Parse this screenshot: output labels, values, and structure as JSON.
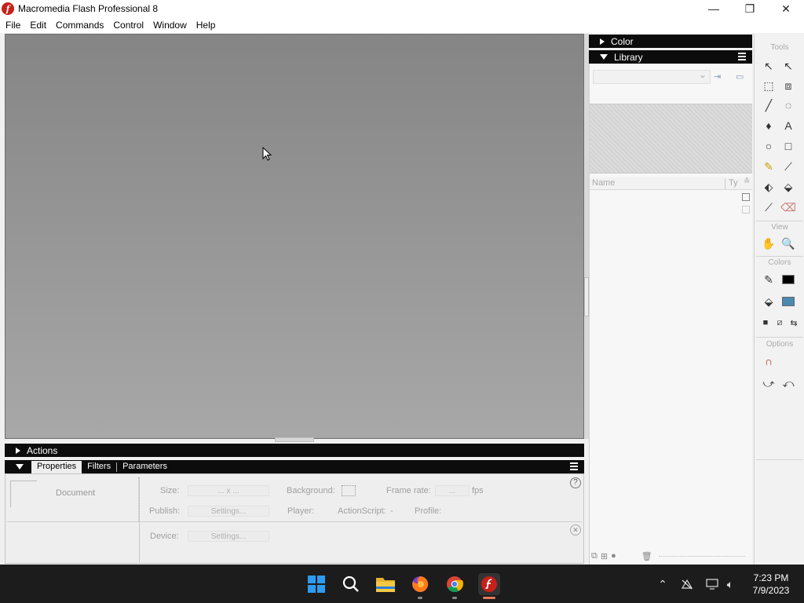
{
  "window": {
    "title": "Macromedia Flash Professional 8",
    "app_icon_glyph": "f",
    "controls": {
      "minimize": "—",
      "maximize": "❐",
      "close": "✕"
    }
  },
  "menu": [
    "File",
    "Edit",
    "Commands",
    "Control",
    "Window",
    "Help"
  ],
  "panels": {
    "actions": {
      "title": "Actions"
    },
    "properties": {
      "tabs": [
        "Properties",
        "Filters",
        "Parameters"
      ],
      "document_label": "Document",
      "size_label": "Size:",
      "size_value": "... x ...",
      "background_label": "Background:",
      "frame_rate_label": "Frame rate:",
      "frame_rate_value": "...",
      "fps_label": "fps",
      "publish_label": "Publish:",
      "settings_button": "Settings...",
      "player_label": "Player:",
      "actionscript_label": "ActionScript:",
      "actionscript_value": "-",
      "profile_label": "Profile:",
      "device_label": "Device:",
      "device_settings_button": "Settings...",
      "help_glyph": "?",
      "close_glyph": "✕"
    },
    "color": {
      "title": "Color"
    },
    "library": {
      "title": "Library",
      "col_name": "Name",
      "col_type": "Ty",
      "sort_glyph": "≙"
    }
  },
  "tools": {
    "tools_label": "Tools",
    "view_label": "View",
    "colors_label": "Colors",
    "options_label": "Options",
    "items": [
      "selection-tool-icon",
      "subselection-tool-icon",
      "free-transform-tool-icon",
      "fill-transform-tool-icon",
      "line-tool-icon",
      "lasso-tool-icon",
      "pen-tool-icon",
      "text-tool-icon",
      "oval-tool-icon",
      "rectangle-tool-icon",
      "pencil-tool-icon",
      "brush-tool-icon",
      "ink-bottle-tool-icon",
      "paint-bucket-tool-icon",
      "eyedropper-tool-icon",
      "eraser-tool-icon"
    ]
  },
  "taskbar": {
    "apps": [
      "start-icon",
      "search-icon",
      "file-explorer-icon",
      "firefox-icon",
      "chrome-icon",
      "flash-icon"
    ],
    "time": "7:23 PM",
    "date": "7/9/2023"
  },
  "colors": {
    "panel_bar": "#0c0c0c",
    "flash_red": "#c8201a",
    "taskbar": "#1c1c1c"
  }
}
